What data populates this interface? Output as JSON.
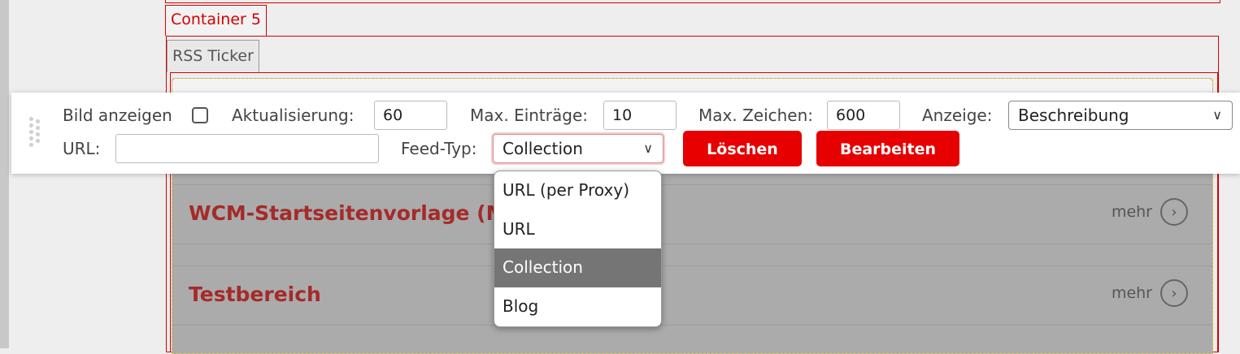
{
  "page": {
    "container_tab": "Container 5",
    "module_tab": "RSS Ticker"
  },
  "news": {
    "items": [
      {
        "title": "WCM-Startseitenvorlage (Mu",
        "more": "mehr"
      },
      {
        "title": "Testbereich",
        "more": "mehr"
      }
    ]
  },
  "toolbar": {
    "show_image_label": "Bild anzeigen",
    "show_image_checked": false,
    "refresh_label": "Aktualisierung:",
    "refresh_value": "60",
    "max_entries_label": "Max. Einträge:",
    "max_entries_value": "10",
    "max_chars_label": "Max. Zeichen:",
    "max_chars_value": "600",
    "display_label": "Anzeige:",
    "display_value": "Beschreibung",
    "url_label": "URL:",
    "url_value": "",
    "feed_type_label": "Feed-Typ:",
    "feed_type_value": "Collection",
    "delete_label": "Löschen",
    "edit_label": "Bearbeiten"
  },
  "feed_type_dropdown": {
    "options": [
      "URL (per Proxy)",
      "URL",
      "Collection",
      "Blog"
    ],
    "selected": "Collection"
  },
  "colors": {
    "accent_red": "#e60000",
    "frame_red": "#d40000",
    "title_red": "#a52a2a",
    "selected_option_bg": "#757575"
  },
  "icons": {
    "drag": "drag-handle-icon",
    "chevron": "chevron-down-icon",
    "more": "chevron-right-circle-icon"
  }
}
